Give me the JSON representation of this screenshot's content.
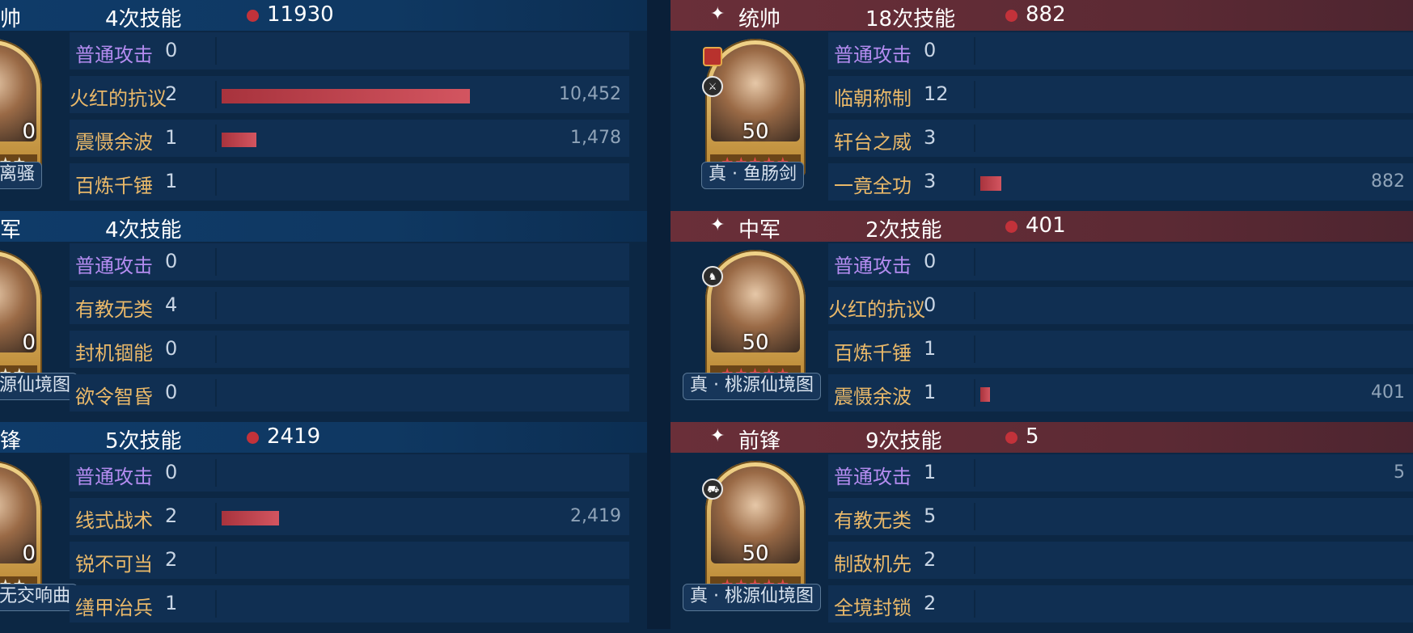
{
  "left": {
    "sections": [
      {
        "role": "帅",
        "skills": "4次技能",
        "damage": "11930",
        "level": "0",
        "caption": "离骚",
        "rows": [
          {
            "name": "普通攻击",
            "count": "0"
          },
          {
            "name": "火红的抗议",
            "count": "2",
            "value": "10,452",
            "share": 0.876
          },
          {
            "name": "震慑余波",
            "count": "1",
            "value": "1,478",
            "share": 0.124
          },
          {
            "name": "百炼千锤",
            "count": "1"
          }
        ]
      },
      {
        "role": "军",
        "skills": "4次技能",
        "level": "0",
        "caption": "源仙境图",
        "rows": [
          {
            "name": "普通攻击",
            "count": "0"
          },
          {
            "name": "有教无类",
            "count": "4"
          },
          {
            "name": "封机锢能",
            "count": "0"
          },
          {
            "name": "欲令智昏",
            "count": "0"
          }
        ]
      },
      {
        "role": "锋",
        "skills": "5次技能",
        "damage": "2419",
        "level": "0",
        "caption": "无交响曲",
        "rows": [
          {
            "name": "普通攻击",
            "count": "0"
          },
          {
            "name": "线式战术",
            "count": "2",
            "value": "2,419",
            "share": 0.203
          },
          {
            "name": "锐不可当",
            "count": "2"
          },
          {
            "name": "缮甲治兵",
            "count": "1"
          }
        ]
      }
    ]
  },
  "right": {
    "star_icon": "✦",
    "sections": [
      {
        "role": "统帅",
        "skills": "18次技能",
        "damage": "882",
        "level": "50",
        "caption": "真 · 鱼肠剑",
        "rows": [
          {
            "name": "普通攻击",
            "count": "0"
          },
          {
            "name": "临朝称制",
            "count": "12"
          },
          {
            "name": "轩台之威",
            "count": "3"
          },
          {
            "name": "一竟全功",
            "count": "3",
            "value": "882",
            "share": 0.074
          }
        ]
      },
      {
        "role": "中军",
        "skills": "2次技能",
        "damage": "401",
        "level": "50",
        "caption": "真 · 桃源仙境图",
        "rows": [
          {
            "name": "普通攻击",
            "count": "0"
          },
          {
            "name": "火红的抗议",
            "count": "0"
          },
          {
            "name": "百炼千锤",
            "count": "1"
          },
          {
            "name": "震慑余波",
            "count": "1",
            "value": "401",
            "share": 0.034
          }
        ]
      },
      {
        "role": "前锋",
        "skills": "9次技能",
        "damage": "5",
        "level": "50",
        "caption": "真 · 桃源仙境图",
        "rows": [
          {
            "name": "普通攻击",
            "count": "1",
            "value": "5"
          },
          {
            "name": "有教无类",
            "count": "5"
          },
          {
            "name": "制敌机先",
            "count": "2"
          },
          {
            "name": "全境封锁",
            "count": "2"
          }
        ]
      }
    ]
  },
  "stars_icon": "★★★★★",
  "colors": {
    "bar": "#c8404b",
    "header_right": "#5c2a34",
    "header_left": "#0f3862",
    "skill_gold": "#e9b869",
    "skill_purple": "#b48cf0"
  }
}
